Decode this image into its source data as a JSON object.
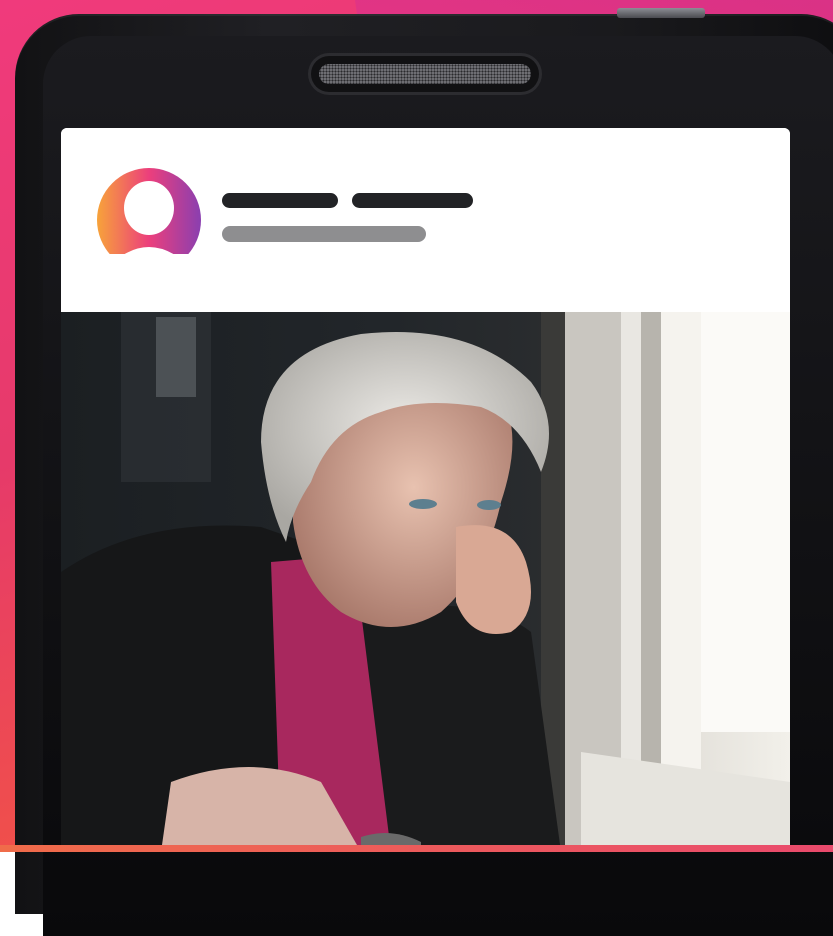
{
  "app": {
    "accent_gradient": [
      "#f7a33a",
      "#ec3f7c",
      "#8a3fb0"
    ],
    "background_gradient": [
      "#f03a7c",
      "#f0504a",
      "#f47a3a"
    ]
  },
  "phone": {
    "speaker_icon": "speaker-grill-icon"
  },
  "post": {
    "avatar_icon": "user-avatar-icon",
    "author_name_placeholder": "",
    "author_meta_placeholder": "",
    "photo_subject": ""
  }
}
